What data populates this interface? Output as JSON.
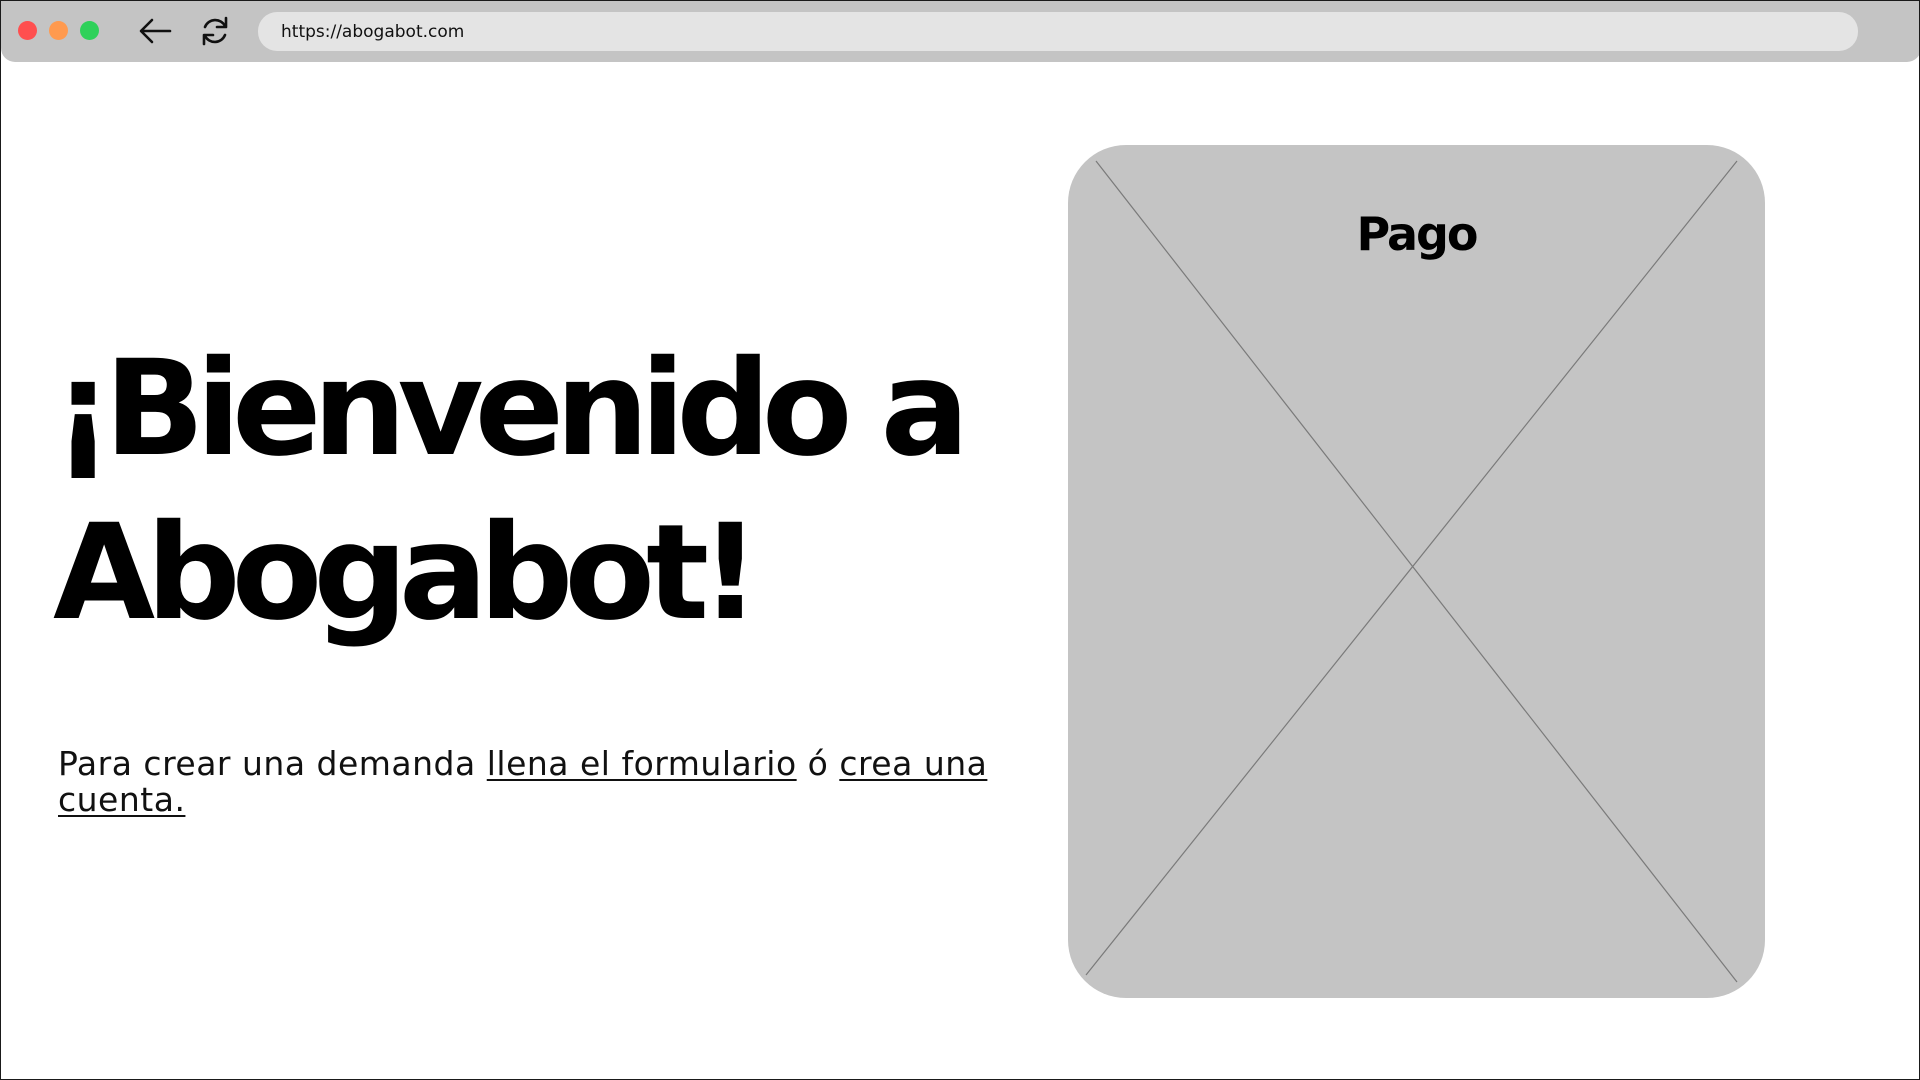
{
  "browser": {
    "url": "https://abogabot.com"
  },
  "hero": {
    "headline_line1": "¡Bienvenido a",
    "headline_line2": "Abogabot!",
    "subtext_prefix": "Para crear una demanda ",
    "link_form": "llena el formulario",
    "subtext_connector": " ó ",
    "link_account": "crea una cuenta."
  },
  "panel": {
    "title": "Pago"
  },
  "colors": {
    "window_chrome": "#c4c4c4",
    "address_bar": "#e4e4e4",
    "placeholder_fill": "#c4c4c4",
    "traffic_red": "#ff4f4f",
    "traffic_orange": "#ff9a4f",
    "traffic_green": "#2fd15a"
  },
  "icons": [
    "back-arrow-icon",
    "reload-icon"
  ]
}
